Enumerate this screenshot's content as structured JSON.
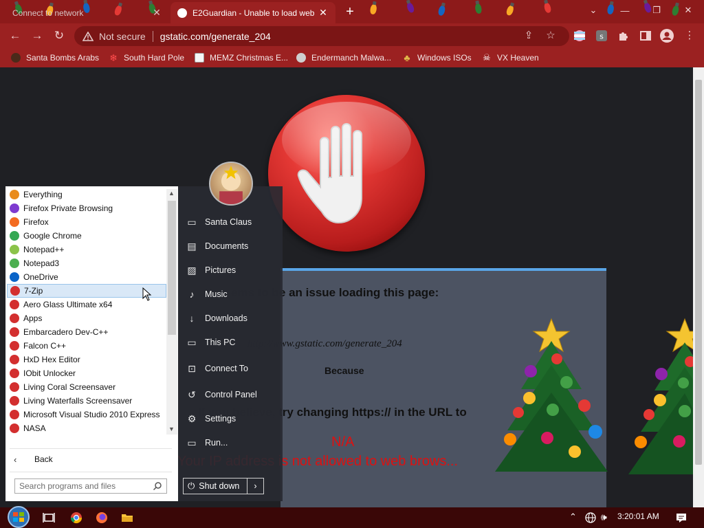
{
  "browser": {
    "tabs": [
      {
        "title": "Connect to network",
        "active": false
      },
      {
        "title": "E2Guardian - Unable to load web",
        "active": true
      }
    ],
    "address_bar": {
      "security_label": "Not secure",
      "url": "gstatic.com/generate_204"
    },
    "bookmarks": [
      {
        "label": "Santa Bombs Arabs",
        "icon": "bomb-icon"
      },
      {
        "label": "South Hard Pole",
        "icon": "snowflake-icon"
      },
      {
        "label": "MEMZ Christmas E...",
        "icon": "page-icon"
      },
      {
        "label": "Endermanch Malwa...",
        "icon": "avatar-icon"
      },
      {
        "label": "Windows ISOs",
        "icon": "tree-icon"
      },
      {
        "label": "VX Heaven",
        "icon": "skull-icon"
      }
    ],
    "colors": {
      "frame": "#9b2121",
      "tabstrip": "#8d1a1a"
    }
  },
  "page": {
    "issue_heading": "ems to be an issue loading this page:",
    "url_line": "http://www.gstatic.com/generate_204",
    "because": "Because",
    "advice": "If you believe, try changing https:// in the URL to",
    "na": "N/A",
    "reason": "Your IP address is not allowed to web brows..."
  },
  "start_menu": {
    "programs": [
      {
        "label": "Everything",
        "color": "#e98b1c"
      },
      {
        "label": "Firefox Private Browsing",
        "color": "#7e3bd0"
      },
      {
        "label": "Firefox",
        "color": "#f36b21"
      },
      {
        "label": "Google Chrome",
        "color": "#34a853"
      },
      {
        "label": "Notepad++",
        "color": "#8bc34a"
      },
      {
        "label": "Notepad3",
        "color": "#4caf50"
      },
      {
        "label": "OneDrive",
        "color": "#0a64c8"
      },
      {
        "label": "7-Zip",
        "color": "#d32f2f",
        "selected": true
      },
      {
        "label": "Aero Glass Ultimate x64",
        "color": "#d32f2f"
      },
      {
        "label": "Apps",
        "color": "#d32f2f"
      },
      {
        "label": "Embarcadero Dev-C++",
        "color": "#d32f2f"
      },
      {
        "label": "Falcon C++",
        "color": "#d32f2f"
      },
      {
        "label": "HxD Hex Editor",
        "color": "#d32f2f"
      },
      {
        "label": "IObit Unlocker",
        "color": "#d32f2f"
      },
      {
        "label": "Living Coral Screensaver",
        "color": "#d32f2f"
      },
      {
        "label": "Living Waterfalls Screensaver",
        "color": "#d32f2f"
      },
      {
        "label": "Microsoft Visual Studio 2010 Express",
        "color": "#d32f2f"
      },
      {
        "label": "NASA",
        "color": "#d32f2f"
      }
    ],
    "back_label": "Back",
    "search_placeholder": "Search programs and files",
    "places": [
      {
        "label": "Santa Claus",
        "icon": "user-folder-icon"
      },
      {
        "label": "Documents",
        "icon": "documents-icon"
      },
      {
        "label": "Pictures",
        "icon": "pictures-icon"
      },
      {
        "label": "Music",
        "icon": "music-icon"
      },
      {
        "label": "Downloads",
        "icon": "downloads-icon"
      },
      {
        "label": "This PC",
        "icon": "computer-icon"
      },
      {
        "label": "Connect To",
        "icon": "connect-icon"
      },
      {
        "label": "Control Panel",
        "icon": "control-panel-icon"
      },
      {
        "label": "Settings",
        "icon": "settings-icon"
      },
      {
        "label": "Run...",
        "icon": "run-icon"
      }
    ],
    "shutdown_label": "Shut down"
  },
  "taskbar": {
    "time": "3:20:01 AM",
    "pinned": [
      "task-view-icon",
      "chrome-icon",
      "firefox-icon",
      "file-explorer-icon"
    ]
  }
}
